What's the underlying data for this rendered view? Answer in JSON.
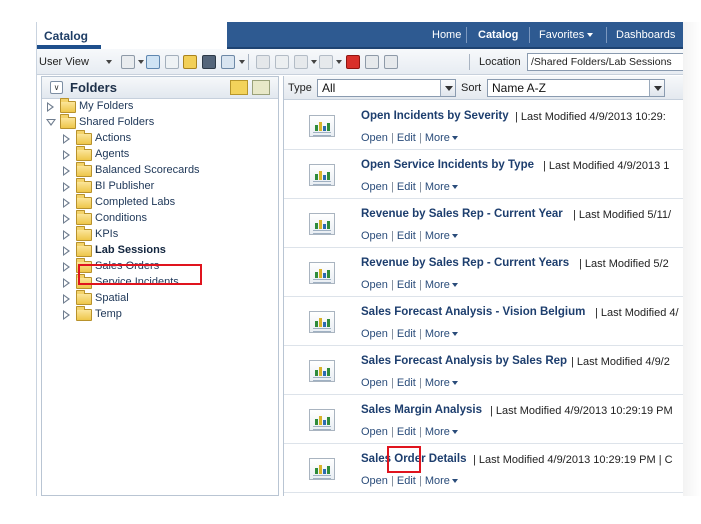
{
  "app": {
    "tab_title": "Catalog"
  },
  "global_nav": {
    "home": "Home",
    "catalog": "Catalog",
    "favorites": "Favorites",
    "dashboards": "Dashboards"
  },
  "toolbar": {
    "user_view": "User View",
    "location_label": "Location",
    "location_value": "/Shared Folders/Lab Sessions"
  },
  "folders": {
    "title": "Folders",
    "tree": [
      {
        "label": "My Folders",
        "expanded": false,
        "level": 0
      },
      {
        "label": "Shared Folders",
        "expanded": true,
        "level": 0
      },
      {
        "label": "Actions",
        "level": 1
      },
      {
        "label": "Agents",
        "level": 1
      },
      {
        "label": "Balanced Scorecards",
        "level": 1
      },
      {
        "label": "BI Publisher",
        "level": 1
      },
      {
        "label": "Completed Labs",
        "level": 1
      },
      {
        "label": "Conditions",
        "level": 1
      },
      {
        "label": "KPIs",
        "level": 1
      },
      {
        "label": "Lab Sessions",
        "level": 1,
        "selected": true
      },
      {
        "label": "Sales Orders",
        "level": 1
      },
      {
        "label": "Service Incidents",
        "level": 1
      },
      {
        "label": "Spatial",
        "level": 1
      },
      {
        "label": "Temp",
        "level": 1
      }
    ]
  },
  "filter": {
    "type_label": "Type",
    "type_value": "All",
    "sort_label": "Sort",
    "sort_value": "Name A-Z"
  },
  "items": [
    {
      "name": "Open Incidents by Severity",
      "modified": "| Last Modified 4/9/2013 10:29:"
    },
    {
      "name": "Open Service Incidents by Type",
      "modified": "| Last Modified 4/9/2013 1"
    },
    {
      "name": "Revenue by Sales Rep - Current Year",
      "modified": "| Last Modified 5/11/"
    },
    {
      "name": "Revenue by Sales Rep - Current Years",
      "modified": "| Last Modified 5/2"
    },
    {
      "name": "Sales Forecast Analysis - Vision Belgium",
      "modified": "| Last Modified 4/"
    },
    {
      "name": "Sales Forecast Analysis by Sales Rep",
      "modified": "| Last Modified 4/9/2"
    },
    {
      "name": "Sales Margin Analysis",
      "modified": "| Last Modified 4/9/2013 10:29:19 PM"
    },
    {
      "name": "Sales Order Details",
      "modified": "| Last Modified 4/9/2013 10:29:19 PM | C"
    }
  ],
  "item_actions": {
    "open": "Open",
    "edit": "Edit",
    "more": "More"
  },
  "colors": {
    "nav_bg": "#2e5a91",
    "highlight": "#e0141e",
    "link": "#1d3e6e"
  }
}
